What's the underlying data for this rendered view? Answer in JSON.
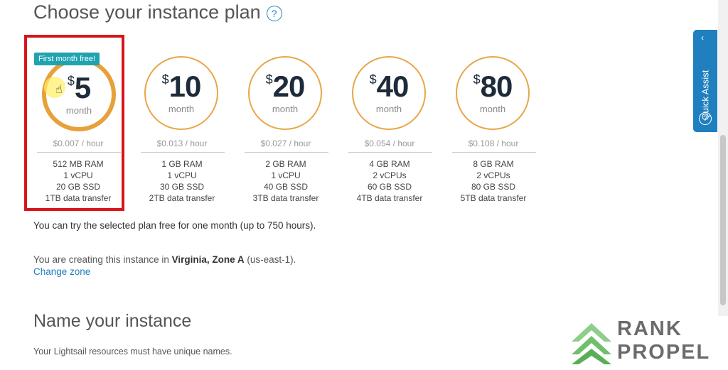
{
  "heading": "Choose your instance plan",
  "help_glyph": "?",
  "badge": "First month free!",
  "currency": "$",
  "plans": [
    {
      "price": "5",
      "per": "month",
      "hourly": "$0.007 / hour",
      "ram": "512 MB RAM",
      "cpu": "1 vCPU",
      "ssd": "20 GB SSD",
      "transfer": "1TB data transfer",
      "selected": true
    },
    {
      "price": "10",
      "per": "month",
      "hourly": "$0.013 / hour",
      "ram": "1 GB RAM",
      "cpu": "1 vCPU",
      "ssd": "30 GB SSD",
      "transfer": "2TB data transfer"
    },
    {
      "price": "20",
      "per": "month",
      "hourly": "$0.027 / hour",
      "ram": "2 GB RAM",
      "cpu": "1 vCPU",
      "ssd": "40 GB SSD",
      "transfer": "3TB data transfer"
    },
    {
      "price": "40",
      "per": "month",
      "hourly": "$0.054 / hour",
      "ram": "4 GB RAM",
      "cpu": "2 vCPUs",
      "ssd": "60 GB SSD",
      "transfer": "4TB data transfer"
    },
    {
      "price": "80",
      "per": "month",
      "hourly": "$0.108 / hour",
      "ram": "8 GB RAM",
      "cpu": "2 vCPUs",
      "ssd": "80 GB SSD",
      "transfer": "5TB data transfer"
    }
  ],
  "free_note": "You can try the selected plan free for one month (up to 750 hours).",
  "zone": {
    "prefix": "You are creating this instance in ",
    "location": "Virginia, Zone A",
    "suffix": " (us-east-1).",
    "change_link": "Change zone"
  },
  "name_section": {
    "heading": "Name your instance",
    "note": "Your Lightsail resources must have unique names."
  },
  "quick_assist": {
    "label": "Quick Assist",
    "chevron": "‹",
    "help": "?"
  },
  "watermark": {
    "line1": "RANK",
    "line2": "PROPEL"
  },
  "colors": {
    "accent": "#1f7fbf",
    "selected_border": "#d7151c",
    "ring": "#e8a13a",
    "badge": "#1fa3b0"
  }
}
